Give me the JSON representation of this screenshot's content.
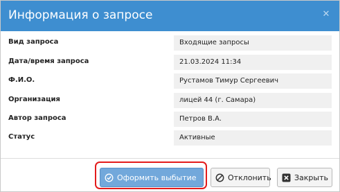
{
  "dialog": {
    "title": "Информация о запросе",
    "close_icon": "close-icon"
  },
  "fields": [
    {
      "label": "Вид запроса",
      "value": "Входящие запросы"
    },
    {
      "label": "Дата/время запроса",
      "value": "21.03.2024 11:34"
    },
    {
      "label": "Ф.И.О.",
      "value": "Рустамов Тимур Сергеевич"
    },
    {
      "label": "Организация",
      "value": "лицей 44 (г. Самара)"
    },
    {
      "label": "Автор запроса",
      "value": "Петров В.А."
    },
    {
      "label": "Статус",
      "value": "Активные"
    }
  ],
  "buttons": {
    "process": {
      "label": "Оформить выбытие",
      "icon": "check-circle-icon"
    },
    "reject": {
      "label": "Отклонить",
      "icon": "ban-icon"
    },
    "close": {
      "label": "Закрыть",
      "icon": "close-square-icon"
    }
  },
  "colors": {
    "titlebar": "#3e8ed0",
    "primary_button": "#72a8db",
    "highlight": "#e31b1b",
    "value_background": "#f0f0f0"
  }
}
